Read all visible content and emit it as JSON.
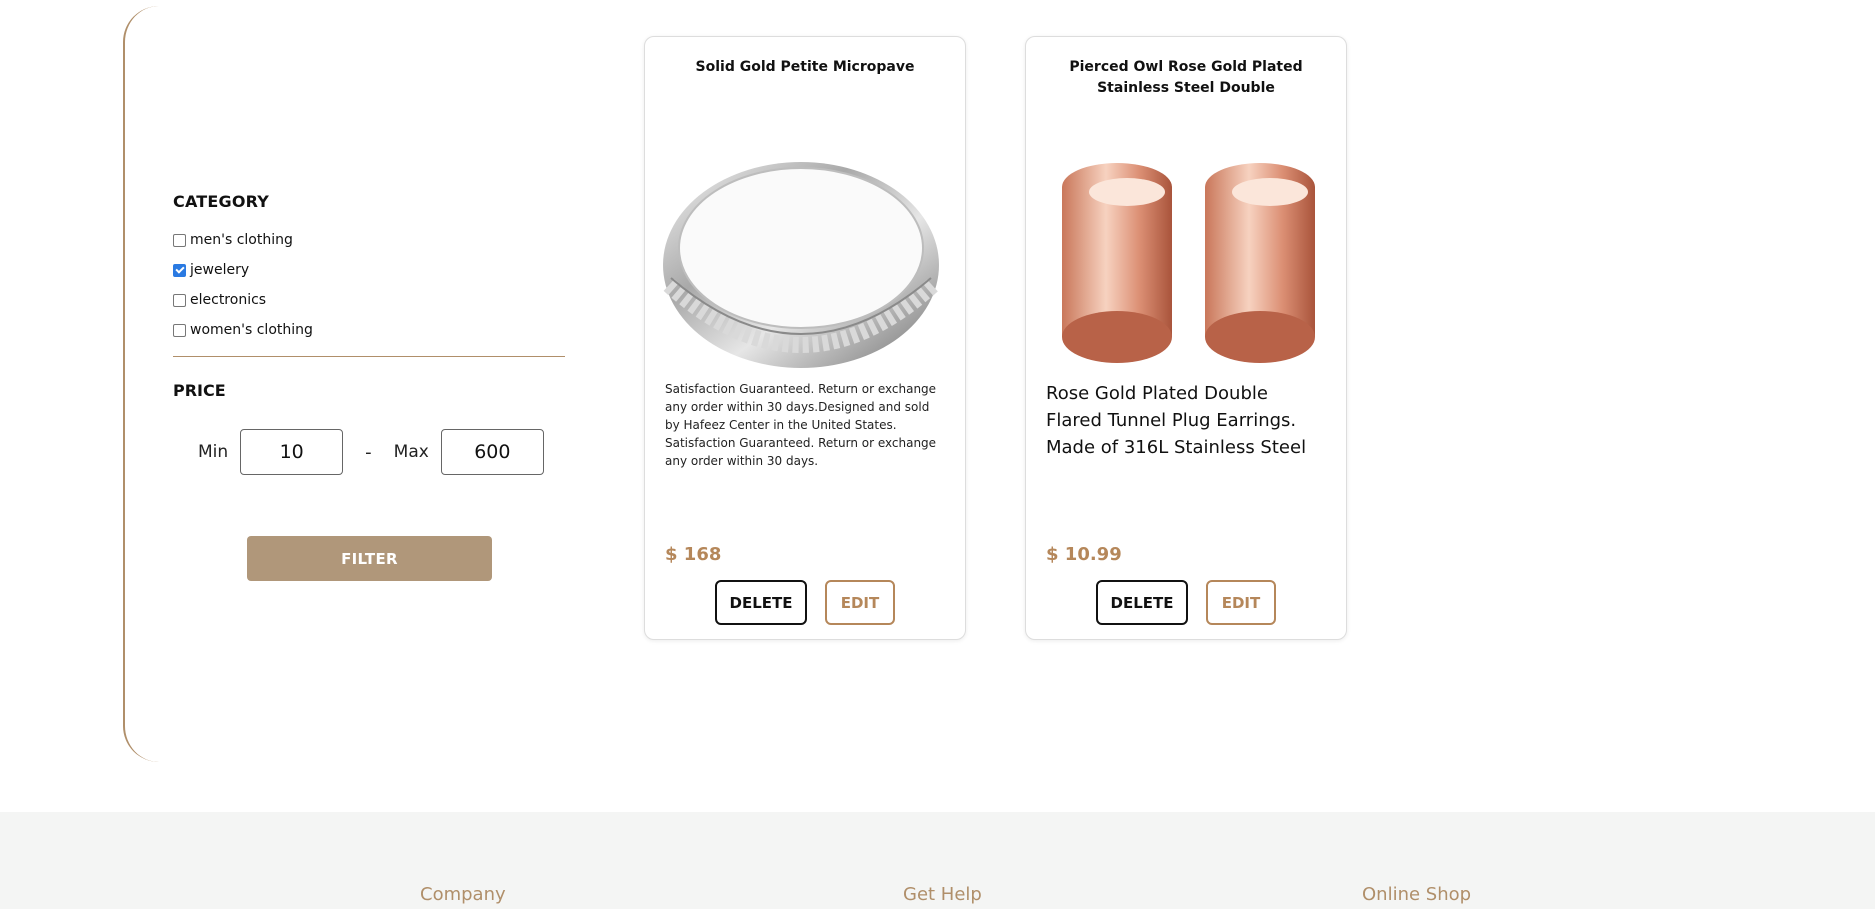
{
  "sidebar": {
    "category_title": "CATEGORY",
    "categories": [
      {
        "label": "men's clothing",
        "checked": false
      },
      {
        "label": "jewelery",
        "checked": true
      },
      {
        "label": "electronics",
        "checked": false
      },
      {
        "label": "women's clothing",
        "checked": false
      }
    ],
    "price_title": "PRICE",
    "min_label": "Min",
    "min_value": "10",
    "dash": "-",
    "max_label": "Max",
    "max_value": "600",
    "filter_label": "FILTER"
  },
  "products": [
    {
      "title": "Solid Gold Petite Micropave",
      "description": "Satisfaction Guaranteed. Return or exchange any order within 30 days.Designed and sold by Hafeez Center in the United States. Satisfaction Guaranteed. Return or exchange any order within 30 days.",
      "price": "$ 168",
      "delete_label": "DELETE",
      "edit_label": "EDIT",
      "image_icon": "ring-image"
    },
    {
      "title": "Pierced Owl Rose Gold Plated Stainless Steel Double",
      "description": "Rose Gold Plated Double Flared Tunnel Plug Earrings. Made of 316L Stainless Steel",
      "price": "$ 10.99",
      "delete_label": "DELETE",
      "edit_label": "EDIT",
      "image_icon": "tunnel-plug-earrings-image"
    }
  ],
  "footer": {
    "columns": [
      "Company",
      "Get Help",
      "Online Shop"
    ]
  },
  "colors": {
    "accent": "#b08f6a",
    "price": "#b5875a",
    "filter_button": "#b0977a",
    "checkbox_checked": "#2a7ae2"
  }
}
